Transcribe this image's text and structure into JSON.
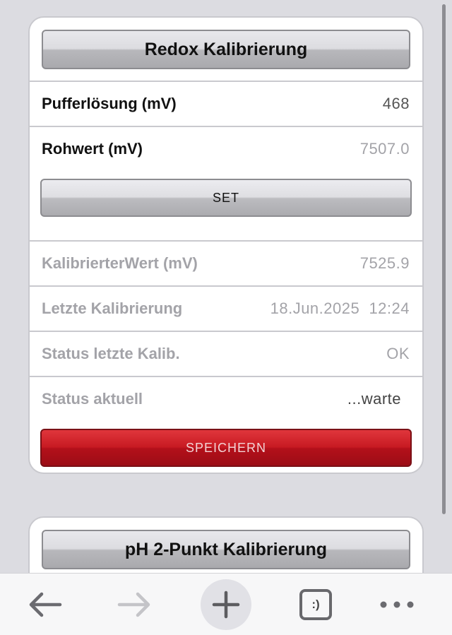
{
  "redox_card": {
    "title": "Redox Kalibrierung",
    "buffer_label": "Pufferlösung (mV)",
    "buffer_value": "468",
    "raw_label": "Rohwert (mV)",
    "raw_value": "7507.0",
    "set_button": "SET",
    "calibrated_label": "KalibrierterWert (mV)",
    "calibrated_value": "7525.9",
    "last_cal_label": "Letzte Kalibrierung",
    "last_cal_value": "18.Jun.2025  12:24",
    "status_last_label": "Status letzte Kalib.",
    "status_last_value": "OK",
    "status_current_label": "Status aktuell",
    "status_current_value": "...warte",
    "save_button": "SPEICHERN"
  },
  "ph_card": {
    "title": "pH 2-Punkt Kalibrierung"
  },
  "toolbar": {
    "back_icon": "arrow-left-icon",
    "forward_icon": "arrow-right-icon",
    "add_icon": "plus-icon",
    "tabs_icon": "tabs-icon",
    "tabs_label": ":)",
    "more_icon": "more-dots-icon"
  },
  "colors": {
    "background": "#dcdce1",
    "save_red": "#c71a22",
    "muted_text": "#a3a3a8"
  }
}
